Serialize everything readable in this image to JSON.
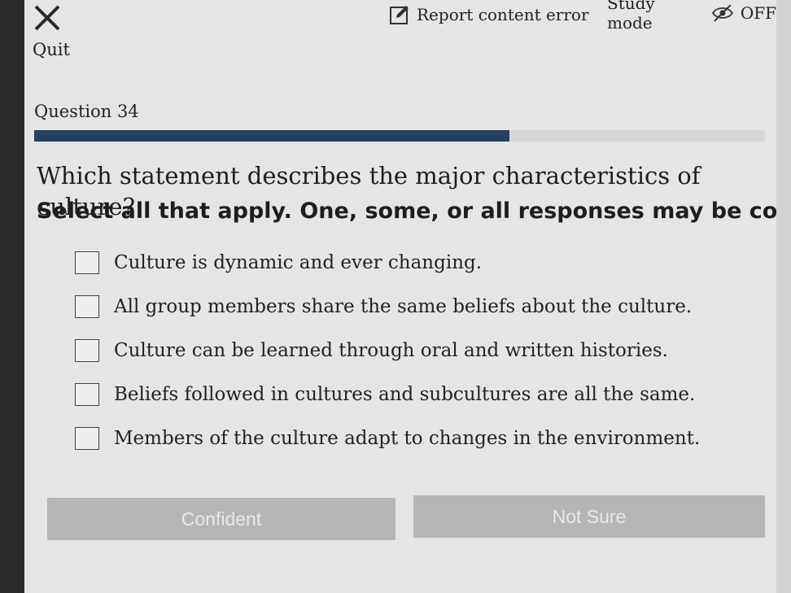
{
  "header": {
    "quit_label": "Quit",
    "report_label": "Report content error",
    "study_mode_label": "Study mode",
    "study_mode_state": "OFF"
  },
  "question": {
    "number_label": "Question 34",
    "progress": 0.65,
    "text": "Which statement describes the major characteristics of culture?",
    "instruction": "Select all that apply. One, some, or all responses may be correct."
  },
  "options": [
    "Culture is dynamic and ever changing.",
    "All group members share the same beliefs about the culture.",
    "Culture can be learned through oral and written histories.",
    "Beliefs followed in cultures and subcultures are all the same.",
    "Members of the culture adapt to changes in the environment."
  ],
  "buttons": {
    "confident": "Confident",
    "not_sure": "Not Sure"
  },
  "colors": {
    "progress_fill": "#23405e",
    "screen_bg": "#e5e5e5",
    "button_bg": "#b5b5b5"
  }
}
